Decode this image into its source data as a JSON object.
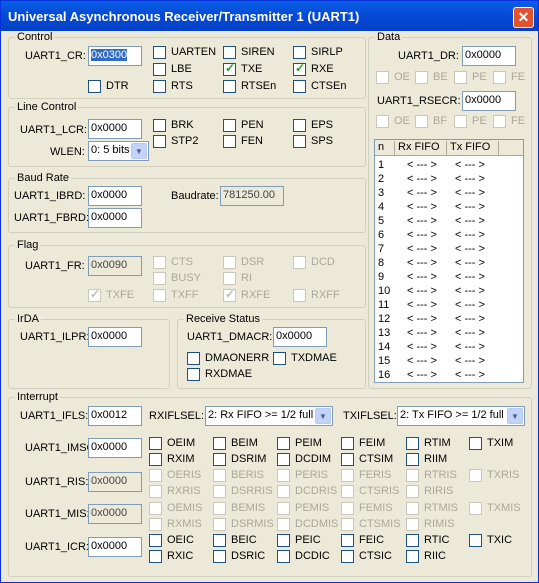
{
  "window": {
    "title": "Universal Asynchronous Receiver/Transmitter 1 (UART1)",
    "close": "✕"
  },
  "control": {
    "label": "Control",
    "cr_label": "UART1_CR:",
    "cr_value": "0x0300",
    "checks": [
      {
        "t": "UARTEN",
        "c": false
      },
      {
        "t": "SIREN",
        "c": false
      },
      {
        "t": "SIRLP",
        "c": false
      },
      {
        "t": "LBE",
        "c": false
      },
      {
        "t": "TXE",
        "c": true
      },
      {
        "t": "RXE",
        "c": true
      },
      {
        "t": "DTR",
        "c": false
      },
      {
        "t": "RTS",
        "c": false
      },
      {
        "t": "RTSEn",
        "c": false
      },
      {
        "t": "CTSEn",
        "c": false
      }
    ]
  },
  "line": {
    "label": "Line Control",
    "lcr_label": "UART1_LCR:",
    "lcr_value": "0x0000",
    "wlen_label": "WLEN:",
    "wlen_value": "0: 5 bits",
    "checks": [
      {
        "t": "BRK",
        "c": false
      },
      {
        "t": "PEN",
        "c": false
      },
      {
        "t": "EPS",
        "c": false
      },
      {
        "t": "STP2",
        "c": false
      },
      {
        "t": "FEN",
        "c": false
      },
      {
        "t": "SPS",
        "c": false
      }
    ]
  },
  "baud": {
    "label": "Baud Rate",
    "ibrd_label": "UART1_IBRD:",
    "ibrd_value": "0x0000",
    "fbrd_label": "UART1_FBRD:",
    "fbrd_value": "0x0000",
    "rate_label": "Baudrate:",
    "rate_value": "781250.00"
  },
  "flag": {
    "label": "Flag",
    "fr_label": "UART1_FR:",
    "fr_value": "0x0090",
    "checks": [
      {
        "t": "CTS",
        "c": false
      },
      {
        "t": "DSR",
        "c": false
      },
      {
        "t": "DCD",
        "c": false
      },
      {
        "t": "BUSY",
        "c": false
      },
      {
        "t": "RI",
        "c": false
      },
      {
        "t": "TXFE",
        "c": true
      },
      {
        "t": "TXFF",
        "c": false
      },
      {
        "t": "RXFE",
        "c": true
      },
      {
        "t": "RXFF",
        "c": false
      }
    ]
  },
  "irda": {
    "label": "IrDA",
    "ilpr_label": "UART1_ILPR:",
    "ilpr_value": "0x0000"
  },
  "rxstatus": {
    "label": "Receive Status",
    "dmacr_label": "UART1_DMACR:",
    "dmacr_value": "0x0000",
    "checks": [
      {
        "t": "DMAONERR",
        "c": false
      },
      {
        "t": "TXDMAE",
        "c": false
      },
      {
        "t": "RXDMAE",
        "c": false
      }
    ]
  },
  "data": {
    "label": "Data",
    "dr_label": "UART1_DR:",
    "dr_value": "0x0000",
    "rsecr_label": "UART1_RSECR:",
    "rsecr_value": "0x0000",
    "flags1": [
      "OE",
      "BE",
      "PE",
      "FE"
    ],
    "flags2": [
      "OE",
      "BF",
      "PE",
      "FE"
    ],
    "fifo_headers": [
      "n",
      "Rx FIFO",
      "Tx FIFO"
    ],
    "fifo_rows": [
      {
        "n": "1",
        "rx": "< --- >",
        "tx": "< --- >"
      },
      {
        "n": "2",
        "rx": "< --- >",
        "tx": "< --- >"
      },
      {
        "n": "3",
        "rx": "< --- >",
        "tx": "< --- >"
      },
      {
        "n": "4",
        "rx": "< --- >",
        "tx": "< --- >"
      },
      {
        "n": "5",
        "rx": "< --- >",
        "tx": "< --- >"
      },
      {
        "n": "6",
        "rx": "< --- >",
        "tx": "< --- >"
      },
      {
        "n": "7",
        "rx": "< --- >",
        "tx": "< --- >"
      },
      {
        "n": "8",
        "rx": "< --- >",
        "tx": "< --- >"
      },
      {
        "n": "9",
        "rx": "< --- >",
        "tx": "< --- >"
      },
      {
        "n": "10",
        "rx": "< --- >",
        "tx": "< --- >"
      },
      {
        "n": "11",
        "rx": "< --- >",
        "tx": "< --- >"
      },
      {
        "n": "12",
        "rx": "< --- >",
        "tx": "< --- >"
      },
      {
        "n": "13",
        "rx": "< --- >",
        "tx": "< --- >"
      },
      {
        "n": "14",
        "rx": "< --- >",
        "tx": "< --- >"
      },
      {
        "n": "15",
        "rx": "< --- >",
        "tx": "< --- >"
      },
      {
        "n": "16",
        "rx": "< --- >",
        "tx": "< --- >"
      }
    ]
  },
  "interrupt": {
    "label": "Interrupt",
    "ifls_label": "UART1_IFLS:",
    "ifls_value": "0x0012",
    "rxiflsel_label": "RXIFLSEL:",
    "rxiflsel_value": "2: Rx FIFO >= 1/2 full",
    "txiflsel_label": "TXIFLSEL:",
    "txiflsel_value": "2: Tx FIFO >= 1/2 full",
    "imsc_label": "UART1_IMSC:",
    "imsc_value": "0x0000",
    "ris_label": "UART1_RIS:",
    "ris_value": "0x0000",
    "mis_label": "UART1_MIS:",
    "mis_value": "0x0000",
    "icr_label": "UART1_ICR:",
    "icr_value": "0x0000",
    "imsc": [
      "OEIM",
      "BEIM",
      "PEIM",
      "FEIM",
      "RTIM",
      "TXIM",
      "RXIM",
      "DSRIM",
      "DCDIM",
      "CTSIM",
      "RIIM"
    ],
    "ris": [
      "OERIS",
      "BERIS",
      "PERIS",
      "FERIS",
      "RTRIS",
      "TXRIS",
      "RXRIS",
      "DSRRIS",
      "DCDRIS",
      "CTSRIS",
      "RIRIS"
    ],
    "mis": [
      "OEMIS",
      "BEMIS",
      "PEMIS",
      "FEMIS",
      "RTMIS",
      "TXMIS",
      "RXMIS",
      "DSRMIS",
      "DCDMIS",
      "CTSMIS",
      "RIMIS"
    ],
    "icr": [
      "OEIC",
      "BEIC",
      "PEIC",
      "FEIC",
      "RTIC",
      "TXIC",
      "RXIC",
      "DSRIC",
      "DCDIC",
      "CTSIC",
      "RIIC"
    ]
  }
}
